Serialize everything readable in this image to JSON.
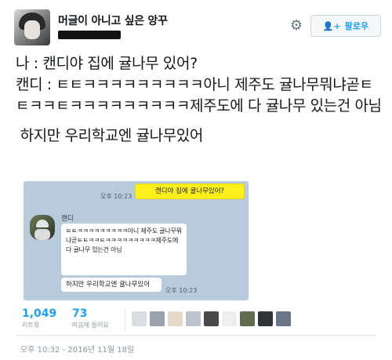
{
  "header": {
    "display_name": "머글이 아니고 싶은 앙꾸",
    "follow_label": "팔로우",
    "icons": {
      "settings": "gear-icon",
      "follow": "add-user-icon"
    }
  },
  "tweet": {
    "lines": [
      "나 : 캔디야 집에 귤나무 있어?",
      "캔디 : ㅌㅌㅋㅋㅋㅋㅋㅋㅋㅋㅋ아니 제주도 귤나무뭐냐곧ㅌㅌㅋㅋㅌㅋㅋㅋㅋㅋㅋㅋㅋㅋ제주도에 다 귤나무 있는건 아님"
    ],
    "last_line": "하지만 우리학교엔 귤나무있어"
  },
  "chat": {
    "my_time": "오후 10:23",
    "my_message": "캔디야 집에 귤나무있어?",
    "sender": "캔디",
    "reply1": "ㅌㅌㅋㅋㅋㅋㅋㅋㅋㅋㅋ아니 제주도 귤나무뭐냐곧ㅌㅌㅋㅋㅌㅋㅋㅋㅋㅋㅋㅋㅋㅋ제주도에 다 귤나무 있는건 아님",
    "reply2": "하지만 우리학교엔 귤나무있어",
    "reply_time": "오후 10:23"
  },
  "stats": {
    "retweets": "1,049",
    "retweets_label": "리트윗",
    "likes": "73",
    "likes_label": "마음에 들어요"
  },
  "timestamp": "오후 10:32 - 2016년 11월 18일",
  "colors": {
    "accent": "#1da1f2",
    "chat_bg": "#b7cbdd",
    "chat_yellow": "#fef01b"
  }
}
